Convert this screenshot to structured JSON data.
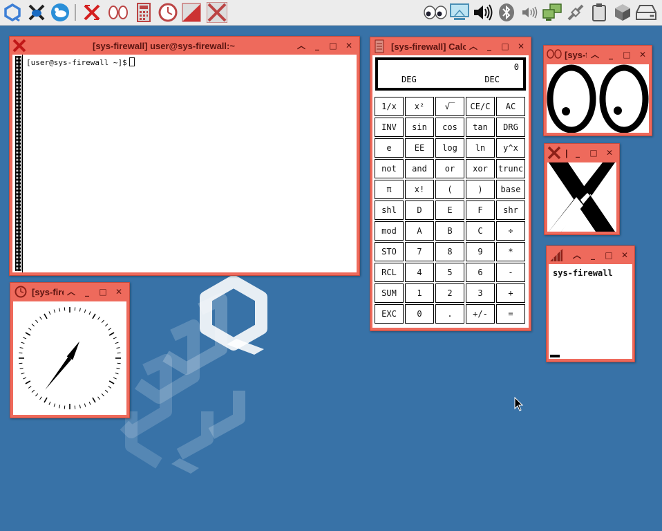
{
  "taskbar": {
    "launchers": [
      {
        "name": "qubes-menu-icon"
      },
      {
        "name": "xkill-icon"
      },
      {
        "name": "xfce-mouse-icon"
      },
      {
        "name": "xlogo-icon"
      },
      {
        "name": "xeyes-icon"
      },
      {
        "name": "calculator-icon"
      },
      {
        "name": "clock-icon"
      },
      {
        "name": "xload-icon"
      },
      {
        "name": "x-icon"
      }
    ],
    "tray": [
      {
        "name": "xeyes-tray-icon"
      },
      {
        "name": "display-tray-icon"
      },
      {
        "name": "volume-tray-icon"
      },
      {
        "name": "bluetooth-tray-icon"
      },
      {
        "name": "volume-small-tray-icon"
      },
      {
        "name": "network-tray-icon"
      },
      {
        "name": "network-off-tray-icon"
      },
      {
        "name": "clipboard-tray-icon"
      },
      {
        "name": "qube-cube-tray-icon"
      },
      {
        "name": "disk-tray-icon"
      }
    ]
  },
  "terminal": {
    "title": "[sys-firewall] user@sys-firewall:~",
    "prompt": "[user@sys-firewall ~]$"
  },
  "clock_window": {
    "title": "[sys-fire",
    "hour_angle": 30,
    "minute_angle": 218
  },
  "calculator": {
    "title": "[sys-firewall] Calc",
    "display": {
      "value": "0",
      "angle_mode": "DEG",
      "base_mode": "DEC"
    },
    "buttons": [
      [
        "1/x",
        "x²",
        "√‾",
        "CE/C",
        "AC"
      ],
      [
        "INV",
        "sin",
        "cos",
        "tan",
        "DRG"
      ],
      [
        "e",
        "EE",
        "log",
        "ln",
        "y^x"
      ],
      [
        "not",
        "and",
        "or",
        "xor",
        "trunc"
      ],
      [
        "π",
        "x!",
        "(",
        ")",
        "base"
      ],
      [
        "shl",
        "D",
        "E",
        "F",
        "shr"
      ],
      [
        "mod",
        "A",
        "B",
        "C",
        "÷"
      ],
      [
        "STO",
        "7",
        "8",
        "9",
        "*"
      ],
      [
        "RCL",
        "4",
        "5",
        "6",
        "-"
      ],
      [
        "SUM",
        "1",
        "2",
        "3",
        "+"
      ],
      [
        "EXC",
        "0",
        ".",
        "+/-",
        "="
      ]
    ]
  },
  "xeyes_window": {
    "title": "[sys-f"
  },
  "xlogo_window": {
    "title": "|"
  },
  "xload_window": {
    "title": "",
    "hostname": "sys-firewall"
  },
  "colors": {
    "desktop": "#3872a7",
    "window_frame": "#ee6a5c",
    "taskbar": "#ececec"
  }
}
